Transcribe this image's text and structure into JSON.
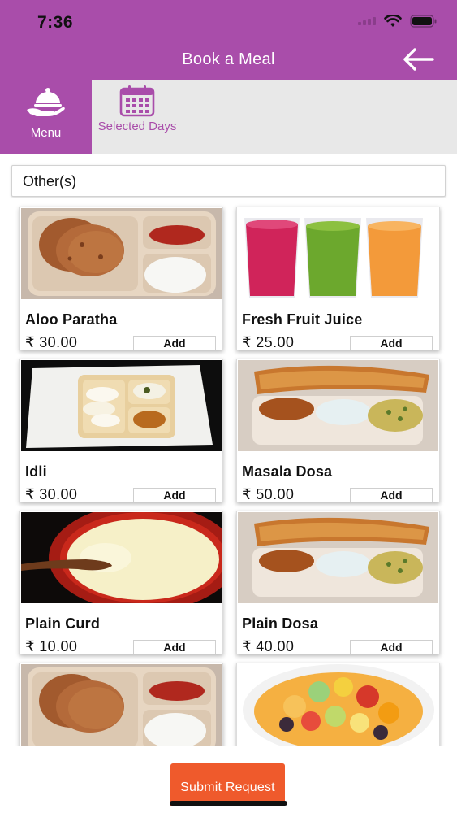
{
  "status_bar": {
    "time": "7:36"
  },
  "header": {
    "title": "Book a Meal"
  },
  "tabs": [
    {
      "label": "Menu",
      "icon": "serving-cloche-icon",
      "active": true
    },
    {
      "label": "Selected Days",
      "icon": "calendar-icon",
      "active": false
    }
  ],
  "category": {
    "selected": "Other(s)"
  },
  "menu_items": [
    {
      "name": "Aloo Paratha",
      "price": "₹ 30.00",
      "add_label": "Add",
      "image": "aloo-paratha-plate"
    },
    {
      "name": "Fresh Fruit Juice",
      "price": "₹ 25.00",
      "add_label": "Add",
      "image": "fruit-juice-glasses"
    },
    {
      "name": "Idli",
      "price": "₹ 30.00",
      "add_label": "Add",
      "image": "idli-plate"
    },
    {
      "name": "Masala Dosa",
      "price": "₹ 50.00",
      "add_label": "Add",
      "image": "masala-dosa-plate"
    },
    {
      "name": "Plain Curd",
      "price": "₹ 10.00",
      "add_label": "Add",
      "image": "curd-bowl"
    },
    {
      "name": "Plain Dosa",
      "price": "₹ 40.00",
      "add_label": "Add",
      "image": "plain-dosa-plate"
    },
    {
      "name": "",
      "price": "",
      "add_label": "",
      "image": "aloo-paratha-plate"
    },
    {
      "name": "",
      "price": "",
      "add_label": "",
      "image": "fruit-salad-bowl"
    }
  ],
  "footer": {
    "submit_label": "Submit Request"
  },
  "colors": {
    "primary": "#a94daa",
    "tab_bg": "#e8e8e8",
    "submit": "#ef5a2c"
  }
}
